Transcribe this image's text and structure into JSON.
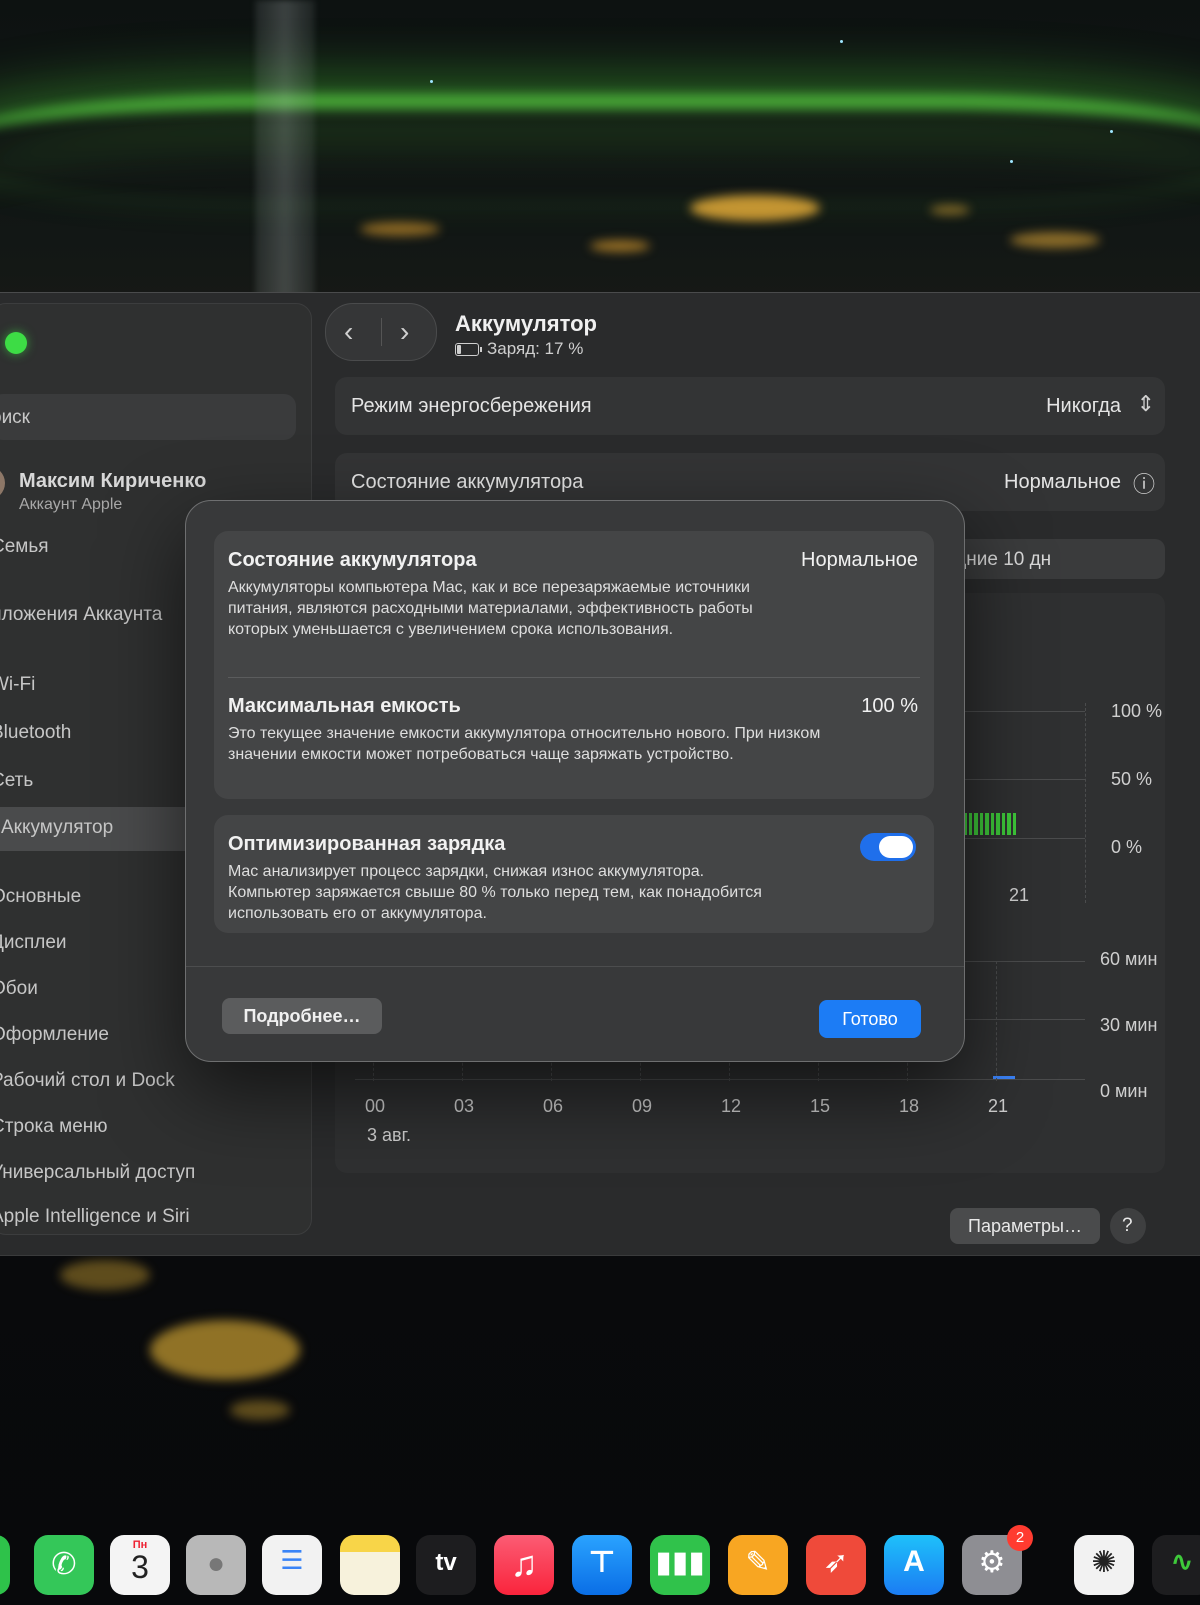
{
  "window": {
    "title": "Аккумулятор",
    "subtitle": "Заряд: 17 %"
  },
  "sidebar": {
    "search_placeholder": "оиск",
    "account": {
      "name": "Максим Кириченко",
      "sub": "Аккаунт Apple"
    },
    "items": [
      {
        "label": "Семья"
      },
      {
        "label": "иложения Аккаунта"
      },
      {
        "label": "Wi-Fi"
      },
      {
        "label": "Bluetooth"
      },
      {
        "label": "Сеть"
      },
      {
        "label": "Аккумулятор",
        "selected": true
      },
      {
        "label": "Основные"
      },
      {
        "label": "Дисплеи"
      },
      {
        "label": "Обои"
      },
      {
        "label": "Оформление"
      },
      {
        "label": "Рабочий стол и Dock"
      },
      {
        "label": "Строка меню"
      },
      {
        "label": "Универсальный доступ"
      },
      {
        "label": "Apple Intelligence и Siri"
      }
    ]
  },
  "settings": {
    "low_power_label": "Режим энергосбережения",
    "low_power_value": "Никогда",
    "health_label": "Состояние аккумулятора",
    "health_value": "Нормальное",
    "period_label": "едние 10 дн"
  },
  "chart": {
    "level_ticks": [
      "100 %",
      "50 %",
      "0 %"
    ],
    "level_day_label": "21",
    "usage_ticks": [
      "60 мин",
      "30 мин",
      "0 мин"
    ],
    "hours": [
      "00",
      "03",
      "06",
      "09",
      "12",
      "15",
      "18",
      "21"
    ],
    "date_label": "3 авг."
  },
  "chart_data": {
    "type": "bar",
    "x": [
      "21"
    ],
    "ylim": [
      0,
      100
    ],
    "y_ticks": [
      "100 %",
      "50 %",
      "0 %"
    ],
    "secondary_y_ticks": [
      "60 мин",
      "30 мин",
      "0 мин"
    ],
    "x_hours": [
      "00",
      "03",
      "06",
      "09",
      "12",
      "15",
      "18",
      "21"
    ],
    "date": "3 авг."
  },
  "buttons": {
    "options": "Параметры…",
    "help": "?"
  },
  "modal": {
    "health_title": "Состояние аккумулятора",
    "health_value": "Нормальное",
    "health_desc": "Аккумуляторы компьютера Mac, как и все перезаряжаемые источники питания, являются расходными материалами, эффективность работы которых уменьшается с увеличением срока использования.",
    "capacity_title": "Максимальная емкость",
    "capacity_value": "100 %",
    "capacity_desc": "Это текущее значение емкости аккумулятора относительно нового. При низком значении емкости может потребоваться чаще заряжать устройство.",
    "optimized_title": "Оптимизированная зарядка",
    "optimized_on": true,
    "optimized_desc": "Mac анализирует процесс зарядки, снижая износ аккумулятора. Компьютер заряжается свыше 80 % только перед тем, как понадобится использовать его от аккумулятора.",
    "more_button": "Подробнее…",
    "done_button": "Готово"
  },
  "dock": {
    "calendar_day": "Пн",
    "calendar_date": "3",
    "tv_label": "tv",
    "settings_badge": "2"
  },
  "colors": {
    "accent": "#1c7cf5",
    "battery_green": "#3ec93a",
    "aurora": "#5fe646"
  }
}
